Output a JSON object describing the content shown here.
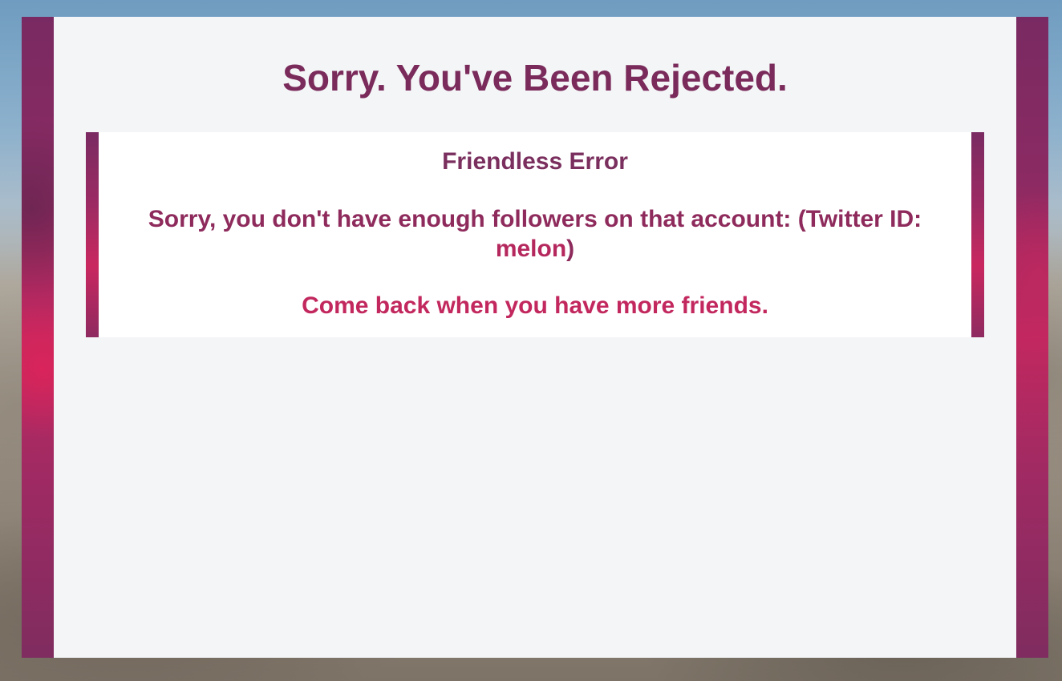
{
  "page": {
    "title": "Sorry. You've Been Rejected."
  },
  "error": {
    "heading": "Friendless Error",
    "detail_prefix": "Sorry, you don't have enough followers on that account: (Twitter ID: ",
    "twitter_id": "melon",
    "detail_suffix": ")",
    "footer": "Come back when you have more friends."
  },
  "colors": {
    "accent": "#7a2b5b",
    "accent_bright": "#c2285e",
    "panel_background": "#f4f5f7"
  }
}
